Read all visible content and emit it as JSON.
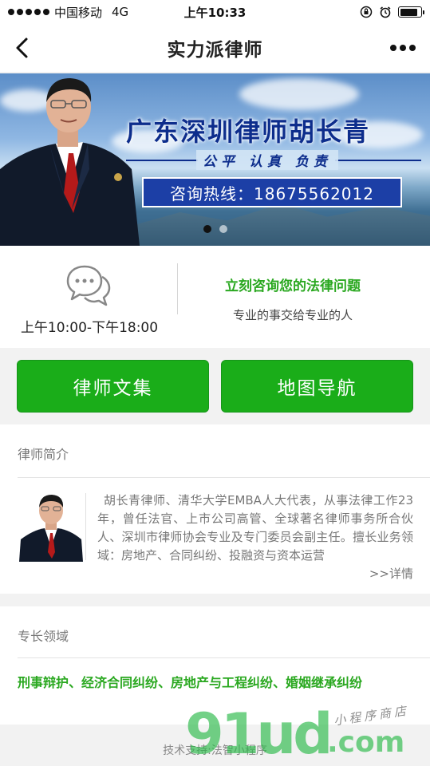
{
  "status_bar": {
    "carrier": "中国移动",
    "network": "4G",
    "time": "上午10:33",
    "battery_level": 0.85
  },
  "nav": {
    "title": "实力派律师",
    "back_icon": "chevron-left-icon",
    "more_icon": "more-dots-icon"
  },
  "banner": {
    "title": "广东深圳律师胡长青",
    "motto": "公平 认真 负责",
    "hotline": "咨询热线：18675562012",
    "slide_count": 2,
    "active_slide": 1
  },
  "info": {
    "chat_icon": "chat-bubbles-icon",
    "hours": "上午10:00-下午18:00",
    "consult_title": "立刻咨询您的法律问题",
    "consult_sub": "专业的事交给专业的人"
  },
  "buttons": {
    "articles": "律师文集",
    "map": "地图导航"
  },
  "intro": {
    "title": "律师简介",
    "text": "胡长青律师、清华大学EMBA人大代表，从事法律工作23年，曾任法官、上市公司高管、全球著名律师事务所合伙人、深圳市律师协会专业及专门委员会副主任。擅长业务领域：房地产、合同纠纷、投融资与资本运营",
    "detail_link": ">>详情"
  },
  "specialty": {
    "title": "专长领域",
    "text": "刑事辩护、经济合同纠纷、房地产与工程纠纷、婚姻继承纠纷"
  },
  "footer": {
    "text": "技术支持:法智小程序"
  },
  "watermark": {
    "main": "91ud",
    "domain": ".com",
    "sub": "小程序商店"
  },
  "colors": {
    "accent_green": "#1aad19",
    "text_green": "#2aa820",
    "banner_blue": "#0d2d8c",
    "hotline_blue": "#1c3fa6"
  }
}
